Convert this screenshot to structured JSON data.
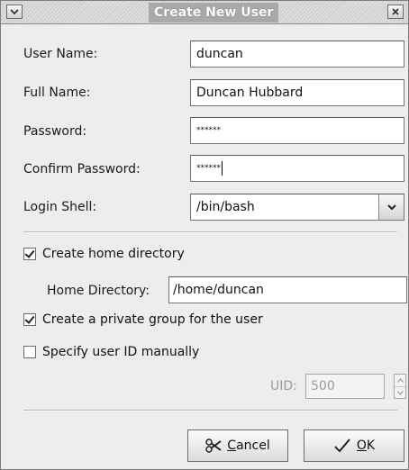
{
  "window": {
    "title": "Create New User"
  },
  "titlebar": {
    "menu_icon": "chevron-down-icon",
    "close_icon": "close-icon"
  },
  "form": {
    "user_name": {
      "label": "User Name:",
      "value": "duncan"
    },
    "full_name": {
      "label": "Full Name:",
      "value": "Duncan Hubbard"
    },
    "password": {
      "label": "Password:",
      "value": "******"
    },
    "confirm_password": {
      "label": "Confirm Password:",
      "value": "******"
    },
    "login_shell": {
      "label": "Login Shell:",
      "value": "/bin/bash"
    }
  },
  "options": {
    "create_home": {
      "label": "Create home directory",
      "checked": true
    },
    "home_directory": {
      "label": "Home Directory:",
      "value": "/home/duncan"
    },
    "private_group": {
      "label": "Create a private group for the user",
      "checked": true
    },
    "specify_uid": {
      "label": "Specify user ID manually",
      "checked": false
    },
    "uid": {
      "label": "UID:",
      "value": "500"
    }
  },
  "buttons": {
    "cancel": {
      "mnemonic": "C",
      "rest": "ancel",
      "icon": "cancel-icon"
    },
    "ok": {
      "mnemonic": "O",
      "rest": "K",
      "icon": "ok-icon"
    }
  }
}
